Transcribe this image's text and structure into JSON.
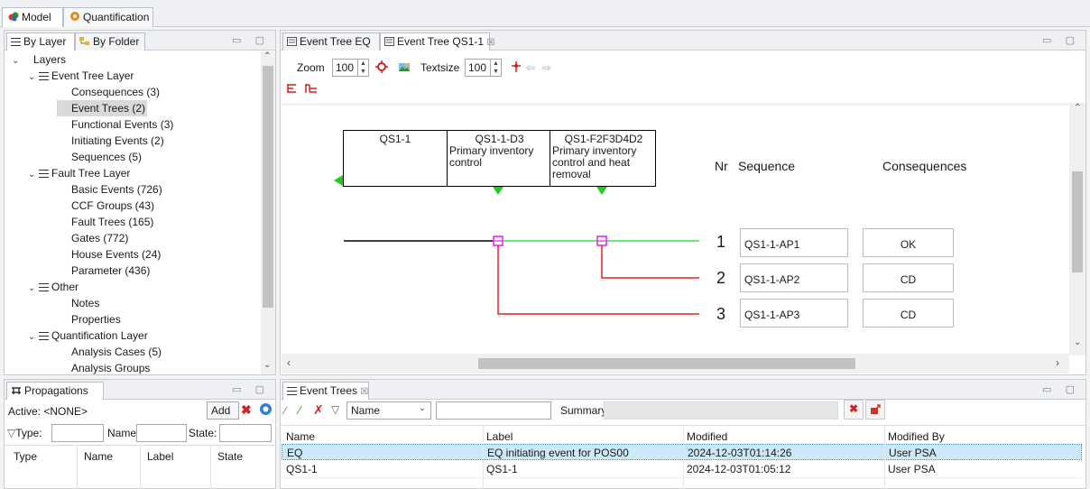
{
  "perspective_tabs": [
    {
      "label": "Model",
      "icon": "model-icon"
    },
    {
      "label": "Quantification",
      "icon": "gear-icon"
    }
  ],
  "nav_view": {
    "tabs": [
      {
        "label": "By Layer"
      },
      {
        "label": "By Folder"
      }
    ],
    "tree": {
      "root": "Layers",
      "event_tree_layer": "Event Tree Layer",
      "consequences": "Consequences  (3)",
      "event_trees": "Event Trees  (2)",
      "functional_events": "Functional Events  (3)",
      "initiating_events": "Initiating Events  (2)",
      "sequences": "Sequences  (5)",
      "fault_tree_layer": "Fault Tree Layer",
      "basic_events": "Basic Events  (726)",
      "ccf_groups": "CCF Groups  (43)",
      "fault_trees": "Fault Trees  (165)",
      "gates": "Gates  (772)",
      "house_events": "House Events  (24)",
      "parameter": "Parameter  (436)",
      "other": "Other",
      "notes": "Notes",
      "properties": "Properties",
      "quantification_layer": "Quantification Layer",
      "analysis_cases": "Analysis Cases  (5)",
      "analysis_groups": "Analysis Groups"
    }
  },
  "editor": {
    "tabs": [
      {
        "label": "Event Tree EQ"
      },
      {
        "label": "Event Tree QS1-1"
      }
    ],
    "close_glyph": "☒",
    "toolbar": {
      "zoom_label": "Zoom",
      "zoom_value": "100",
      "textsize_label": "Textsize",
      "textsize_value": "100"
    },
    "diagram": {
      "headers": [
        {
          "line1": "QS1-1",
          "line2": "",
          "line3": ""
        },
        {
          "line1": "QS1-1-D3",
          "line2": "Primary inventory",
          "line3": "control",
          "line4": ""
        },
        {
          "line1": "QS1-F2F3D4D2",
          "line2": "Primary inventory",
          "line3": "control and heat",
          "line4": "removal"
        }
      ],
      "col_nr": "Nr",
      "col_sequence": "Sequence",
      "col_consequences": "Consequences",
      "rows": [
        {
          "nr": "1",
          "sequence": "QS1-1-AP1",
          "consequence": "OK"
        },
        {
          "nr": "2",
          "sequence": "QS1-1-AP2",
          "consequence": "CD"
        },
        {
          "nr": "3",
          "sequence": "QS1-1-AP3",
          "consequence": "CD"
        }
      ],
      "colors": {
        "success": "#3ee03e",
        "failure": "#e82020",
        "initiator": "#000000",
        "node": "#e020e0",
        "triangle": "#22cc22"
      }
    }
  },
  "propagations": {
    "tab": "Propagations",
    "active_label": "Active: <NONE>",
    "add_label": "Add",
    "filter": {
      "type": "Type:",
      "name": "Name:",
      "state": "State:"
    },
    "columns": [
      "Type",
      "Name",
      "Label",
      "State"
    ]
  },
  "event_trees_view": {
    "tab": "Event Trees",
    "filter_field": "Name",
    "summary_label": "Summary:",
    "columns": [
      "Name",
      "Label",
      "Modified",
      "Modified By"
    ],
    "rows": [
      {
        "name": "EQ",
        "label": "EQ initiating event for POS00",
        "modified": "2024-12-03T01:14:26",
        "by": "User PSA"
      },
      {
        "name": "QS1-1",
        "label": "QS1-1",
        "modified": "2024-12-03T01:05:12",
        "by": "User PSA"
      }
    ]
  }
}
